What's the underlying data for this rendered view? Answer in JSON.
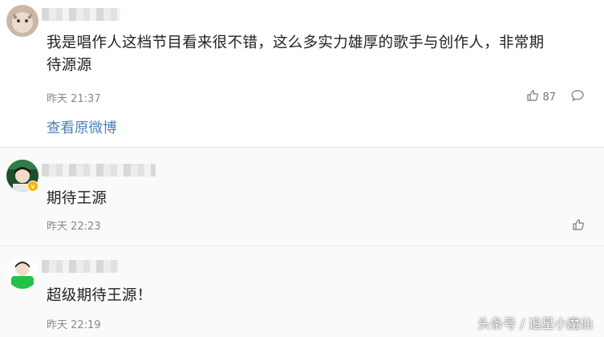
{
  "comments": [
    {
      "text_line1": "我是唱作人这档节目看来很不错，这么多实力雄厚的歌手与创作人，非常期",
      "text_line2": "待源源",
      "time": "昨天 21:37",
      "like_count": "87",
      "view_original": "查看原微博"
    },
    {
      "text": "期待王源",
      "time": "昨天 22:23",
      "verified_badge": "v"
    },
    {
      "text": "超级期待王源！",
      "time": "昨天 22:19"
    }
  ],
  "watermark": "头条号 / 追星小魔仙",
  "colors": {
    "link": "#4a7fb5",
    "badge": "#f5b400"
  },
  "icons": [
    "thumb-up-icon",
    "comment-icon"
  ]
}
